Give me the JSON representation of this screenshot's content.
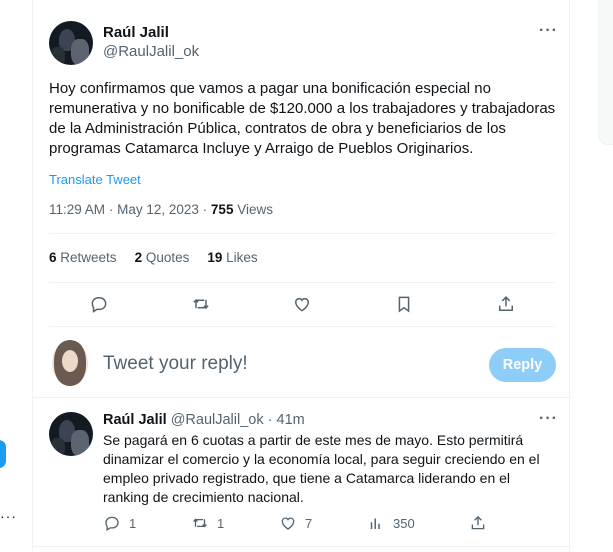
{
  "main_tweet": {
    "author_name": "Raúl Jalil",
    "author_handle": "@RaulJalil_ok",
    "more_label": "···",
    "text": "Hoy confirmamos que vamos a pagar una bonificación especial no remunerativa y no bonificable de $120.000 a los trabajadores y trabajadoras de la Administración Pública, contratos de obra y beneficiarios de los programas Catamarca Incluye y Arraigo de Pueblos Originarios.",
    "translate_label": "Translate Tweet",
    "time": "11:29 AM",
    "separator": "·",
    "date": "May 12, 2023",
    "views_count": "755",
    "views_label": "Views",
    "stats": {
      "retweets_count": "6",
      "retweets_label": "Retweets",
      "quotes_count": "2",
      "quotes_label": "Quotes",
      "likes_count": "19",
      "likes_label": "Likes"
    },
    "actions": [
      "reply-icon",
      "retweet-icon",
      "like-icon",
      "bookmark-icon",
      "share-icon"
    ]
  },
  "reply_box": {
    "placeholder": "Tweet your reply!",
    "button_label": "Reply"
  },
  "reply_tweet": {
    "author_name": "Raúl Jalil",
    "author_handle": "@RaulJalil_ok",
    "separator": "·",
    "time_ago": "41m",
    "more_label": "···",
    "text": "Se pagará en 6 cuotas a partir de este mes de mayo. Esto permitirá dinamizar el comercio y la economía local, para seguir creciendo en el empleo privado registrado, que tiene a Catamarca liderando en el ranking de crecimiento nacional.",
    "replies": "1",
    "retweets": "1",
    "likes": "7",
    "views": "350"
  },
  "left_rail": {
    "more_label": "···"
  },
  "colors": {
    "accent": "#1d9bf0",
    "reply_button_disabled": "#8ecdf8",
    "text_secondary": "#536471",
    "divider": "#eff3f4"
  }
}
